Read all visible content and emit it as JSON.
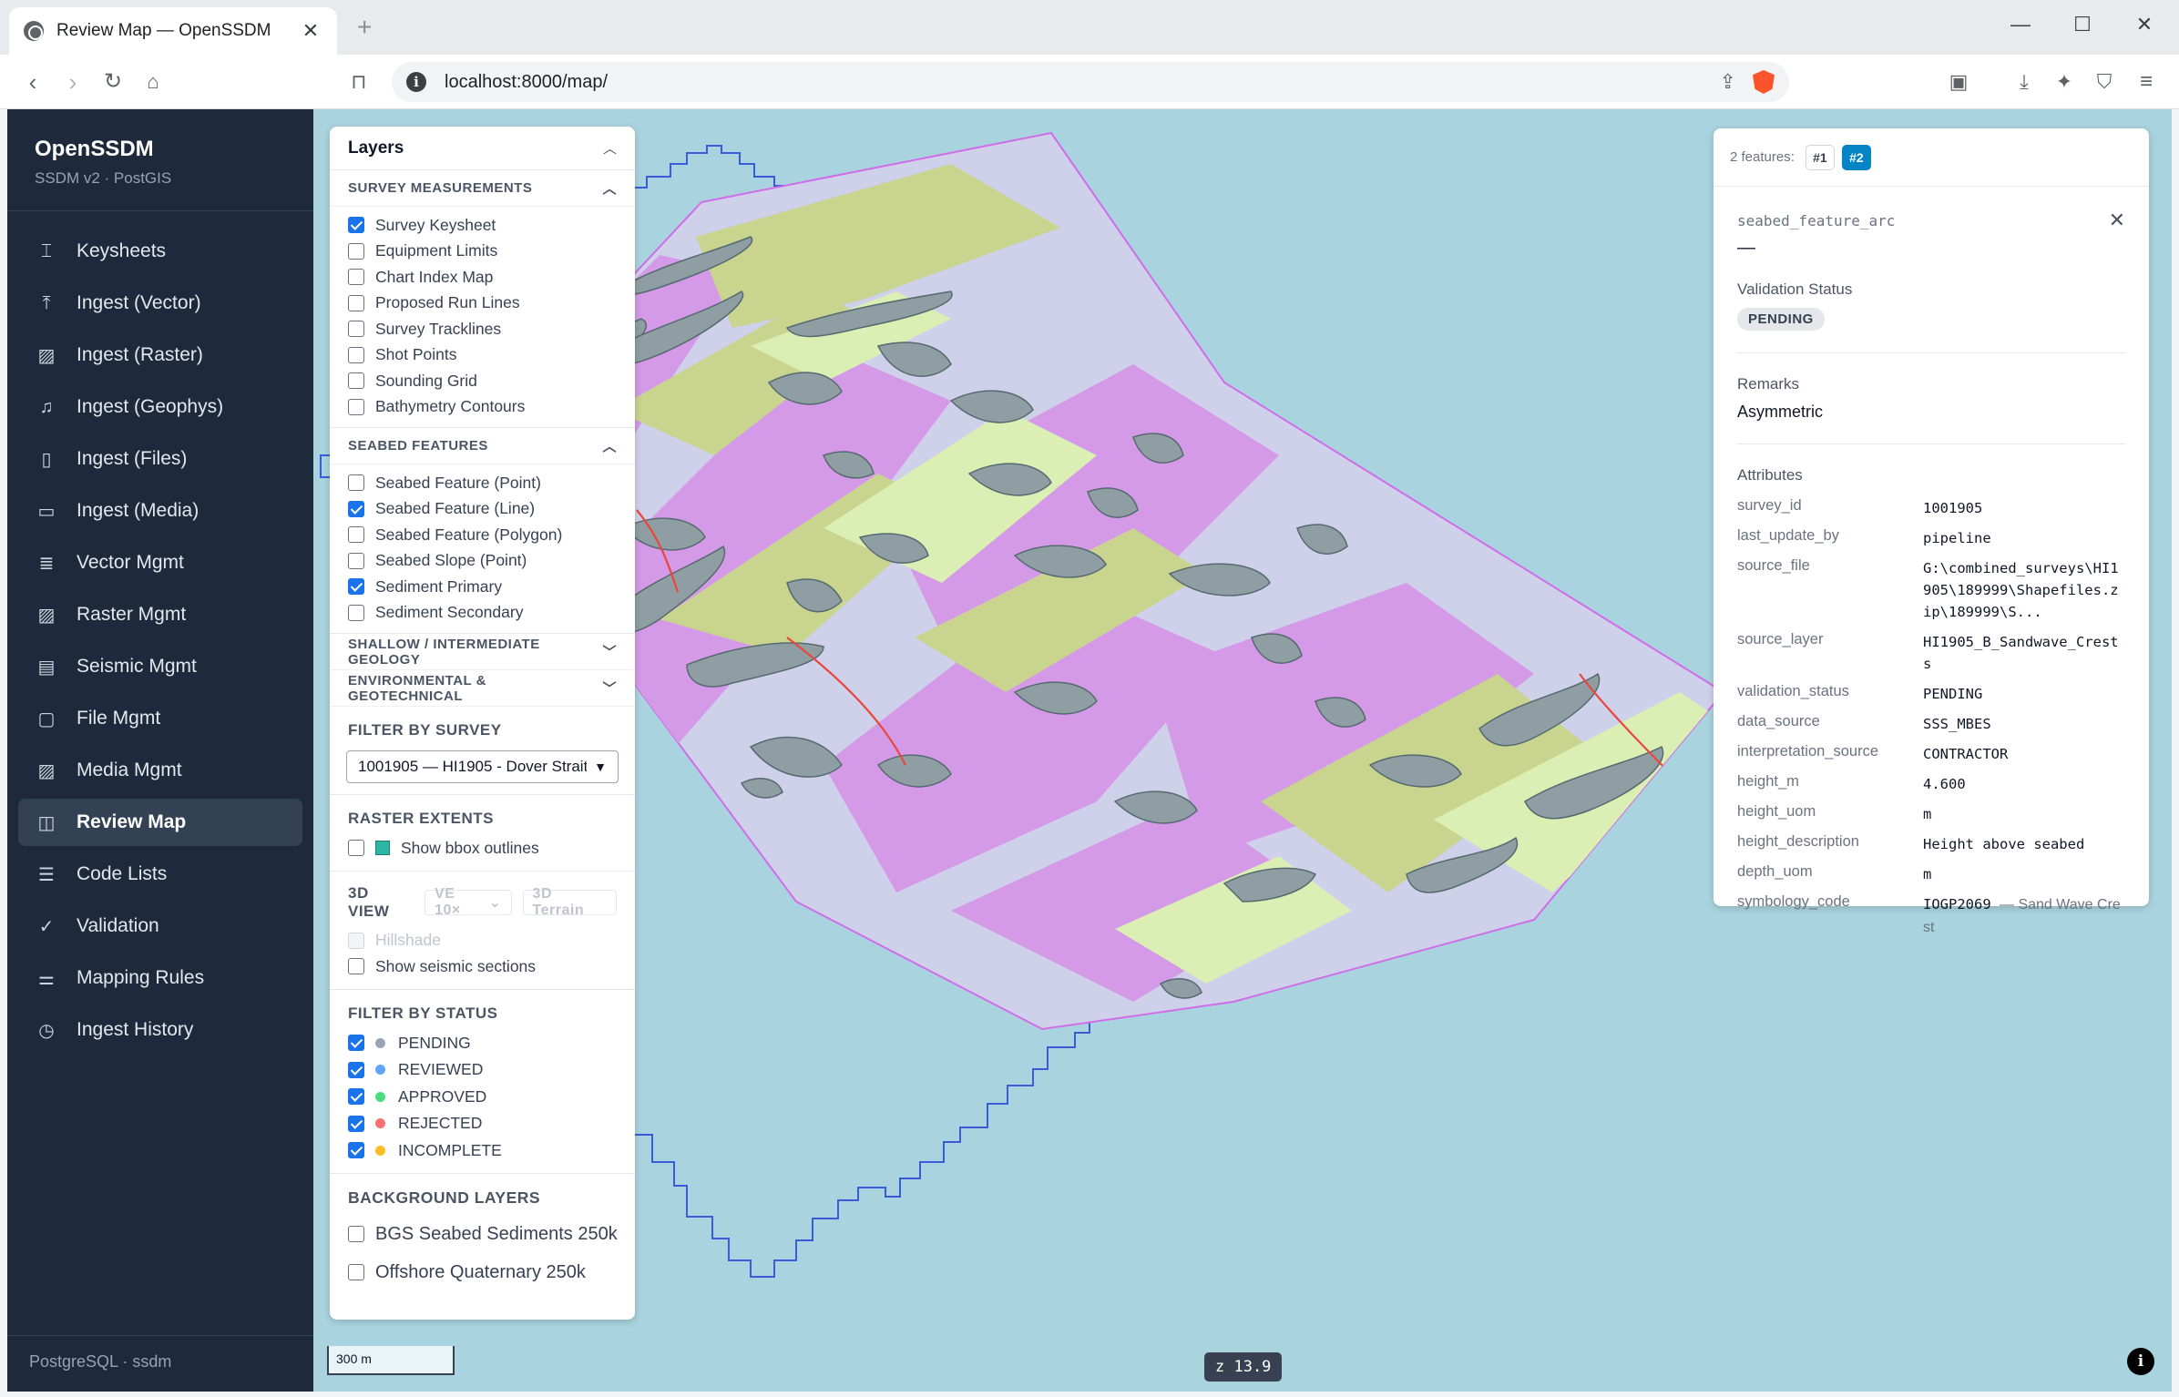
{
  "browser": {
    "tab_title": "Review Map — OpenSSDM",
    "url": "localhost:8000/map/"
  },
  "app": {
    "name": "OpenSSDM",
    "subtitle": "SSDM v2 · PostGIS",
    "footer": "PostgreSQL · ssdm"
  },
  "nav": [
    {
      "label": "Keysheets",
      "icon": "keysheet-icon"
    },
    {
      "label": "Ingest (Vector)",
      "icon": "upload-icon"
    },
    {
      "label": "Ingest (Raster)",
      "icon": "image-icon"
    },
    {
      "label": "Ingest (Geophys)",
      "icon": "music-note-icon"
    },
    {
      "label": "Ingest (Files)",
      "icon": "file-icon"
    },
    {
      "label": "Ingest (Media)",
      "icon": "media-icon"
    },
    {
      "label": "Vector Mgmt",
      "icon": "layers-list-icon"
    },
    {
      "label": "Raster Mgmt",
      "icon": "image-icon"
    },
    {
      "label": "Seismic Mgmt",
      "icon": "chart-icon"
    },
    {
      "label": "File Mgmt",
      "icon": "folder-icon"
    },
    {
      "label": "Media Mgmt",
      "icon": "image-icon"
    },
    {
      "label": "Review Map",
      "icon": "map-icon",
      "active": true
    },
    {
      "label": "Code Lists",
      "icon": "list-icon"
    },
    {
      "label": "Validation",
      "icon": "check-circle-icon"
    },
    {
      "label": "Mapping Rules",
      "icon": "sliders-icon"
    },
    {
      "label": "Ingest History",
      "icon": "clock-icon"
    }
  ],
  "layers": {
    "title": "Layers",
    "groups": [
      {
        "title": "SURVEY MEASUREMENTS",
        "expanded": true,
        "items": [
          {
            "label": "Survey Keysheet",
            "checked": true
          },
          {
            "label": "Equipment Limits",
            "checked": false
          },
          {
            "label": "Chart Index Map",
            "checked": false
          },
          {
            "label": "Proposed Run Lines",
            "checked": false
          },
          {
            "label": "Survey Tracklines",
            "checked": false
          },
          {
            "label": "Shot Points",
            "checked": false
          },
          {
            "label": "Sounding Grid",
            "checked": false
          },
          {
            "label": "Bathymetry Contours",
            "checked": false
          }
        ]
      },
      {
        "title": "SEABED FEATURES",
        "expanded": true,
        "items": [
          {
            "label": "Seabed Feature (Point)",
            "checked": false
          },
          {
            "label": "Seabed Feature (Line)",
            "checked": true
          },
          {
            "label": "Seabed Feature (Polygon)",
            "checked": false
          },
          {
            "label": "Seabed Slope (Point)",
            "checked": false
          },
          {
            "label": "Sediment Primary",
            "checked": true
          },
          {
            "label": "Sediment Secondary",
            "checked": false
          }
        ]
      },
      {
        "title": "SHALLOW / INTERMEDIATE GEOLOGY",
        "expanded": false,
        "items": []
      },
      {
        "title": "ENVIRONMENTAL & GEOTECHNICAL",
        "expanded": false,
        "items": []
      }
    ],
    "filter_survey": {
      "title": "FILTER BY SURVEY",
      "selected": "1001905 — HI1905 - Dover Strait"
    },
    "raster_extents": {
      "title": "RASTER EXTENTS",
      "bbox_label": "Show bbox outlines"
    },
    "view3d": {
      "title": "3D VIEW",
      "ve": "VE 10×",
      "terrain": "3D Terrain",
      "hillshade": "Hillshade",
      "seismic": "Show seismic sections"
    },
    "filter_status": {
      "title": "FILTER BY STATUS",
      "items": [
        {
          "label": "PENDING",
          "color": "#9aa5b4"
        },
        {
          "label": "REVIEWED",
          "color": "#60a5fa"
        },
        {
          "label": "APPROVED",
          "color": "#4ade80"
        },
        {
          "label": "REJECTED",
          "color": "#f87171"
        },
        {
          "label": "INCOMPLETE",
          "color": "#fbbf24"
        }
      ]
    },
    "background": {
      "title": "BACKGROUND LAYERS",
      "items": [
        "BGS Seabed Sediments 250k",
        "Offshore Quaternary 250k"
      ]
    }
  },
  "feature": {
    "count_label": "2 features:",
    "pills": [
      "#1",
      "#2"
    ],
    "active_pill": 1,
    "type": "seabed_feature_arc",
    "dash": "—",
    "validation_label": "Validation Status",
    "validation_value": "PENDING",
    "remarks_label": "Remarks",
    "remarks_value": "Asymmetric",
    "attributes_label": "Attributes",
    "attributes": [
      {
        "key": "survey_id",
        "value": "1001905"
      },
      {
        "key": "last_update_by",
        "value": "pipeline"
      },
      {
        "key": "source_file",
        "value": "G:\\combined_surveys\\HI1905\\189999\\Shapefiles.zip\\189999\\S..."
      },
      {
        "key": "source_layer",
        "value": "HI1905_B_Sandwave_Crests"
      },
      {
        "key": "validation_status",
        "value": "PENDING"
      },
      {
        "key": "data_source",
        "value": "SSS_MBES"
      },
      {
        "key": "interpretation_source",
        "value": "CONTRACTOR"
      },
      {
        "key": "height_m",
        "value": "4.600"
      },
      {
        "key": "height_uom",
        "value": "m"
      },
      {
        "key": "height_description",
        "value": "Height above seabed"
      },
      {
        "key": "depth_uom",
        "value": "m"
      },
      {
        "key": "symbology_code",
        "value": "IOGP2069",
        "extra": "— Sand Wave Crest"
      }
    ]
  },
  "map": {
    "scale_label": "300 m",
    "zoom_label": "z 13.9",
    "attribution": "i",
    "colors": {
      "water": "#a9d3de",
      "purple": "#d49ae8",
      "lavender": "#cfd0ea",
      "olive": "#c9d48f",
      "lightgreen": "#dbeeb3",
      "grey": "#8e9ea2",
      "red": "#e8473e"
    }
  }
}
